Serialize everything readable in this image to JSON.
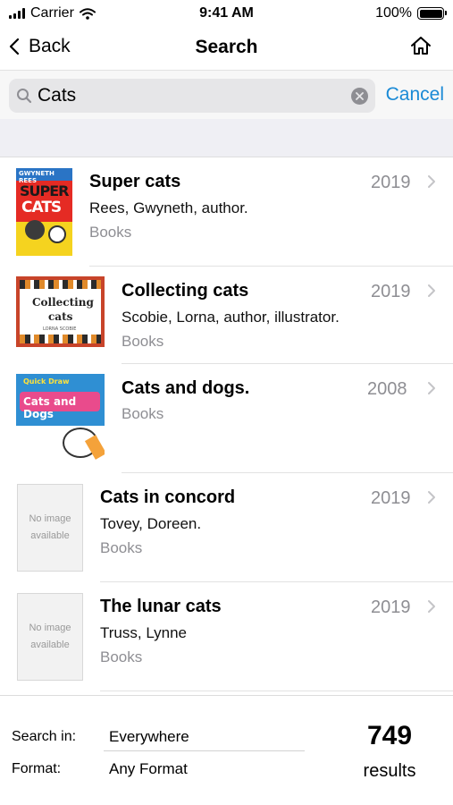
{
  "status_bar": {
    "carrier": "Carrier",
    "time": "9:41 AM",
    "battery": "100%"
  },
  "nav": {
    "back_label": "Back",
    "title": "Search"
  },
  "search": {
    "query": "Cats",
    "cancel_label": "Cancel"
  },
  "results": [
    {
      "title": "Super cats",
      "author": "Rees, Gwyneth, author.",
      "format": "Books",
      "year": "2019",
      "cover": {
        "line1": "GWYNETH REES",
        "line2": "SUPER",
        "line3": "CATS"
      }
    },
    {
      "title": "Collecting cats",
      "author": "Scobie, Lorna, author, illustrator.",
      "format": "Books",
      "year": "2019",
      "cover": {
        "line1": "Collecting",
        "line2": "cats",
        "line3": "LORNA SCOBIE"
      }
    },
    {
      "title": "Cats and dogs.",
      "author": "",
      "format": "Books",
      "year": "2008",
      "cover": {
        "line1": "Quick Draw",
        "line2": "Cats and Dogs"
      }
    },
    {
      "title": "Cats in concord",
      "author": "Tovey, Doreen.",
      "format": "Books",
      "year": "2019",
      "cover": {
        "noimage": "No image available"
      }
    },
    {
      "title": "The lunar cats",
      "author": "Truss, Lynne",
      "format": "Books",
      "year": "2019",
      "cover": {
        "noimage": "No image available"
      }
    }
  ],
  "footer": {
    "search_in_label": "Search in:",
    "search_in_value": "Everywhere",
    "format_label": "Format:",
    "format_value": "Any Format",
    "count": "749",
    "count_label": "results"
  },
  "colors": {
    "accent": "#1a8ad6",
    "secondary_text": "#8e8e93"
  },
  "icons": [
    "signal-icon",
    "wifi-icon",
    "battery-icon",
    "back-chevron-icon",
    "home-icon",
    "search-icon",
    "clear-icon",
    "chevron-right-icon"
  ]
}
